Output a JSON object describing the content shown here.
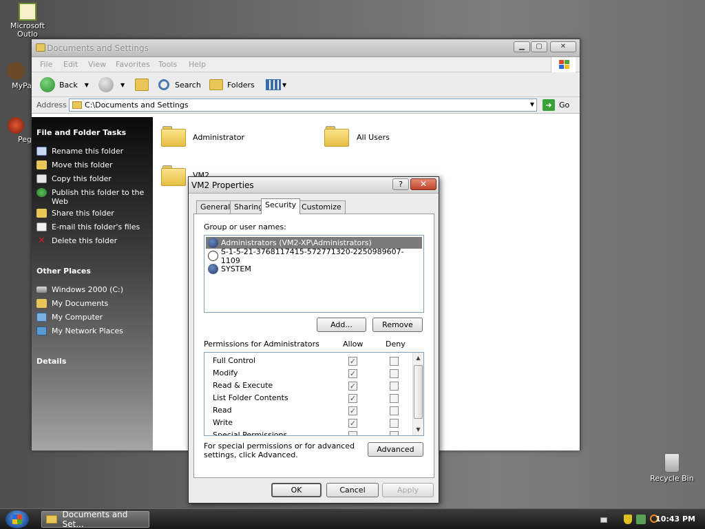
{
  "desktop": {
    "icons": [
      {
        "label": "Microsoft Outlo"
      },
      {
        "label": "MyPa"
      },
      {
        "label": "Peg"
      },
      {
        "label": "Recycle Bin"
      }
    ]
  },
  "explorer": {
    "title": "Documents and Settings",
    "menu": [
      "File",
      "Edit",
      "View",
      "Favorites",
      "Tools",
      "Help"
    ],
    "toolbar": {
      "back": "Back",
      "search": "Search",
      "folders": "Folders"
    },
    "address": {
      "label": "Address",
      "value": "C:\\Documents and Settings",
      "go": "Go"
    },
    "tasks": {
      "header": "File and Folder Tasks",
      "items": [
        {
          "label": "Rename this folder"
        },
        {
          "label": "Move this folder"
        },
        {
          "label": "Copy this folder"
        },
        {
          "label": "Publish this folder to the Web"
        },
        {
          "label": "Share this folder"
        },
        {
          "label": "E-mail this folder's files"
        },
        {
          "label": "Delete this folder"
        }
      ]
    },
    "places": {
      "header": "Other Places",
      "items": [
        {
          "label": "Windows 2000 (C:)"
        },
        {
          "label": "My Documents"
        },
        {
          "label": "My Computer"
        },
        {
          "label": "My Network Places"
        }
      ]
    },
    "details": {
      "header": "Details"
    },
    "folders": [
      {
        "name": "Administrator"
      },
      {
        "name": "All Users"
      },
      {
        "name": "VM2"
      }
    ]
  },
  "dialog": {
    "title": "VM2 Properties",
    "help": "?",
    "close": "✕",
    "tabs": [
      "General",
      "Sharing",
      "Security",
      "Customize"
    ],
    "active_tab": "Security",
    "group_label": "Group or user names:",
    "users": [
      {
        "name": "Administrators (VM2-XP\\Administrators)",
        "selected": true
      },
      {
        "name": "S-1-5-21-3768117415-572771320-2250989607-1109",
        "selected": false
      },
      {
        "name": "SYSTEM",
        "selected": false
      }
    ],
    "add_button": "Add...",
    "remove_button": "Remove",
    "permissions_label": "Permissions for Administrators",
    "allow_header": "Allow",
    "deny_header": "Deny",
    "permissions": [
      {
        "name": "Full Control",
        "allow": true,
        "deny": false
      },
      {
        "name": "Modify",
        "allow": true,
        "deny": false
      },
      {
        "name": "Read & Execute",
        "allow": true,
        "deny": false
      },
      {
        "name": "List Folder Contents",
        "allow": true,
        "deny": false
      },
      {
        "name": "Read",
        "allow": true,
        "deny": false
      },
      {
        "name": "Write",
        "allow": true,
        "deny": false
      },
      {
        "name": "Special Permissions",
        "allow": false,
        "deny": false
      }
    ],
    "advanced_text": "For special permissions or for advanced settings, click Advanced.",
    "advanced_button": "Advanced",
    "ok": "OK",
    "cancel": "Cancel",
    "apply": "Apply"
  },
  "taskbar": {
    "task": "Documents and Set...",
    "clock": "10:43 PM"
  }
}
